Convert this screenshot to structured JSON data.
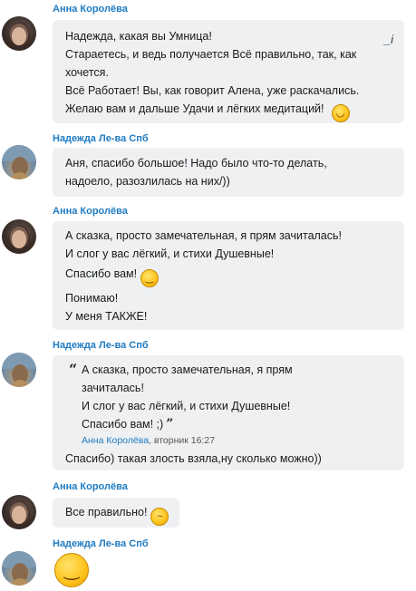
{
  "messages": [
    {
      "sender": "Анна Королёва",
      "lines": [
        "Надежда, какая  вы Умница!",
        "Стараетесь, и ведь получается Всё правильно, так, как",
        "хочется.",
        "Всё Работает! Вы, как говорит Алена, уже раскачались.",
        "Желаю вам и дальше Удачи и лёгких медитаций!"
      ],
      "edited_marker": "_i",
      "emoji": "grinning-face"
    },
    {
      "sender": "Надежда Ле-ва Спб",
      "lines": [
        "Аня, спасибо большое! Надо было что-то делать,",
        "надоело, разозлилась на них/))"
      ]
    },
    {
      "sender": "Анна Королёва",
      "lines": [
        "А сказка, просто замечательная, я прям зачиталась!",
        "И слог у вас лёгкий,  и стихи Душевные!",
        "Спасибо вам!",
        "Понимаю!",
        "У меня ТАКЖЕ!"
      ],
      "emoji": "winking-face"
    },
    {
      "sender": "Надежда Ле-ва Спб",
      "quote": {
        "lines": [
          "А сказка, просто замечательная, я прям",
          "зачиталась!",
          "И слог у вас лёгкий,  и стихи Душевные!",
          "Спасибо вам! ;)"
        ],
        "author": "Анна Королёва",
        "date": ", вторник 16:27"
      },
      "reply": "Спасибо) такая злость взяла,ну сколько можно))"
    },
    {
      "sender": "Анна Королёва",
      "lines": [
        "Все правильно!"
      ],
      "emoji": "thinking-face"
    },
    {
      "sender": "Надежда Ле-ва Спб",
      "emoji": "winking-face-large"
    }
  ]
}
